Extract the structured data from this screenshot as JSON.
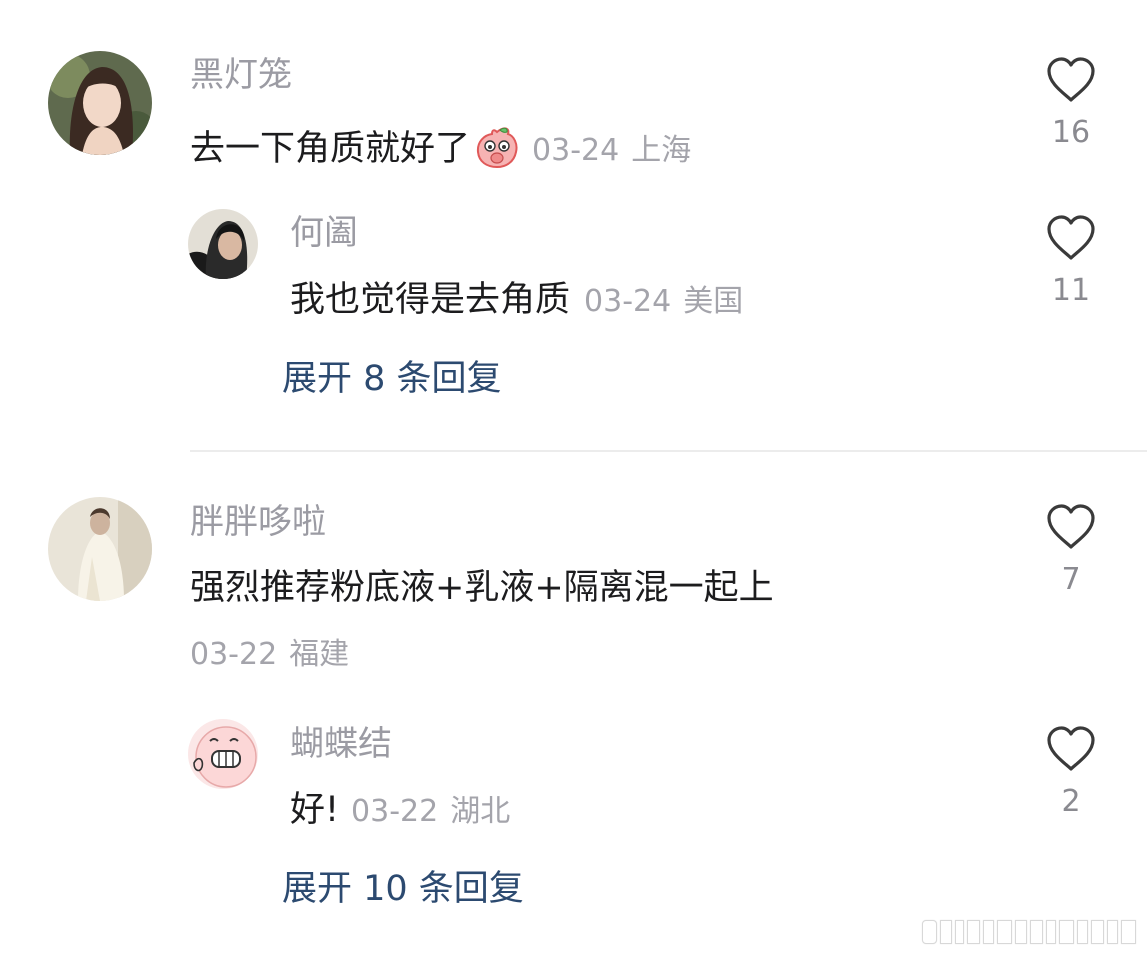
{
  "comments": [
    {
      "user": "黑灯笼",
      "text": "去一下角质就好了",
      "emoji": "peach-face-emoji",
      "date": "03-24",
      "location": "上海",
      "likes": "16",
      "replies": [
        {
          "user": "何阖",
          "text": "我也觉得是去角质",
          "date": "03-24",
          "location": "美国",
          "likes": "11"
        }
      ],
      "expand_label": "展开 8 条回复"
    },
    {
      "user": "胖胖哆啦",
      "text": "强烈推荐粉底液+乳液+隔离混一起上",
      "date": "03-22",
      "location": "福建",
      "likes": "7",
      "replies": [
        {
          "user": "蝴蝶结",
          "text": "好!",
          "date": "03-22",
          "location": "湖北",
          "likes": "2"
        }
      ],
      "expand_label": "展开 10 条回复"
    }
  ],
  "colors": {
    "username": "#9b9ba3",
    "text": "#1c1c1e",
    "meta": "#a4a4ab",
    "link": "#2c4a70",
    "divider": "#ececec"
  }
}
